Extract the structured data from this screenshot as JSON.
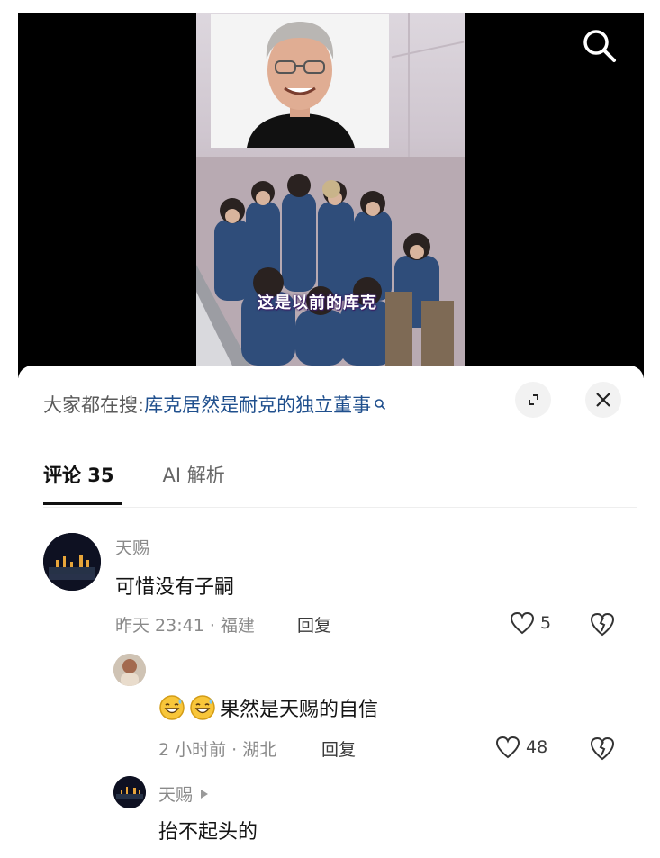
{
  "video": {
    "caption": "这是以前的库克"
  },
  "search_bar": {
    "prefix": "大家都在搜:",
    "query": "库克居然是耐克的独立董事"
  },
  "tabs": [
    {
      "label": "评论 35"
    },
    {
      "label": "AI 解析"
    }
  ],
  "comments": [
    {
      "user": "天赐",
      "text": "可惜没有子嗣",
      "meta": "昨天 23:41 · 福建",
      "reply_label": "回复",
      "likes": "5"
    },
    {
      "user": "",
      "text": "果然是天赐的自信",
      "meta": "2 小时前 · 湖北",
      "reply_label": "回复",
      "likes": "48"
    },
    {
      "user": "天赐",
      "text": "抬不起头的"
    }
  ],
  "colors": {
    "link": "#1f4f8d",
    "caption_shadow": "#3a1d63"
  }
}
